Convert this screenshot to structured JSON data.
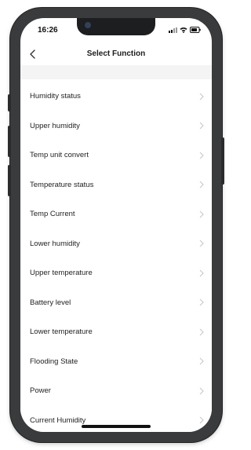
{
  "status_bar": {
    "time": "16:26",
    "icons": [
      "signal-icon",
      "wifi-icon",
      "battery-icon"
    ]
  },
  "header": {
    "title": "Select Function",
    "back_icon": "chevron-left-icon"
  },
  "functions": [
    {
      "label": "Humidity status"
    },
    {
      "label": "Upper humidity"
    },
    {
      "label": "Temp unit convert"
    },
    {
      "label": "Temperature status"
    },
    {
      "label": "Temp Current"
    },
    {
      "label": "Lower humidity"
    },
    {
      "label": "Upper temperature"
    },
    {
      "label": "Battery level"
    },
    {
      "label": "Lower temperature"
    },
    {
      "label": "Flooding State"
    },
    {
      "label": "Power"
    },
    {
      "label": "Current Humidity"
    }
  ],
  "colors": {
    "phone_frame": "#3a3b3d",
    "screen_bg": "#ffffff",
    "band_bg": "#f4f4f4",
    "text": "#222222",
    "chevron": "#c8c8c8"
  }
}
